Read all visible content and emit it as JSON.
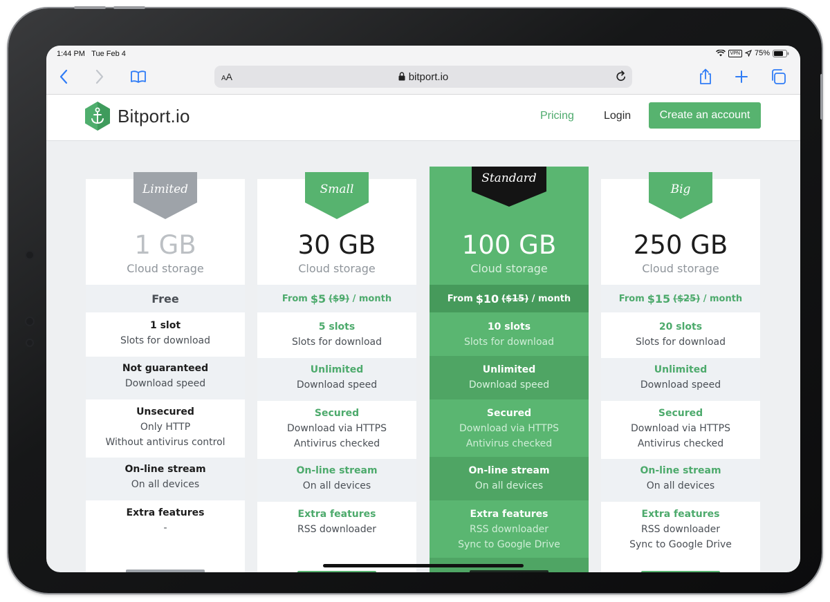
{
  "status": {
    "time": "1:44 PM",
    "date": "Tue Feb 4",
    "vpn": "VPN",
    "battery": "75%"
  },
  "browser": {
    "text_size_label_small": "A",
    "text_size_label_large": "A",
    "host": "bitport.io"
  },
  "site": {
    "logo_text": "Bitport.io",
    "nav_pricing": "Pricing",
    "nav_login": "Login",
    "cta": "Create an account",
    "accent": "#57b36f"
  },
  "plans": [
    {
      "name": "Limited",
      "size": "1 GB",
      "sub": "Cloud storage",
      "price_free": "Free",
      "slots_title": "1 slot",
      "slots_desc": "Slots for download",
      "speed_title": "Not guaranteed",
      "speed_desc": "Download speed",
      "sec_title": "Unsecured",
      "sec_desc1": "Only HTTP",
      "sec_desc2": "Without antivirus control",
      "stream_title": "On-line stream",
      "stream_desc": "On all devices",
      "extra_title": "Extra features",
      "extra_desc1": "-"
    },
    {
      "name": "Small",
      "size": "30 GB",
      "sub": "Cloud storage",
      "price_from": "From",
      "price": "$5",
      "price_old": "($9)",
      "price_per": "/ month",
      "slots_title": "5 slots",
      "slots_desc": "Slots for download",
      "speed_title": "Unlimited",
      "speed_desc": "Download speed",
      "sec_title": "Secured",
      "sec_desc1": "Download via HTTPS",
      "sec_desc2": "Antivirus checked",
      "stream_title": "On-line stream",
      "stream_desc": "On all devices",
      "extra_title": "Extra features",
      "extra_desc1": "RSS downloader"
    },
    {
      "name": "Standard",
      "size": "100 GB",
      "sub": "Cloud storage",
      "price_from": "From",
      "price": "$10",
      "price_old": "($15)",
      "price_per": "/ month",
      "slots_title": "10 slots",
      "slots_desc": "Slots for download",
      "speed_title": "Unlimited",
      "speed_desc": "Download speed",
      "sec_title": "Secured",
      "sec_desc1": "Download via HTTPS",
      "sec_desc2": "Antivirus checked",
      "stream_title": "On-line stream",
      "stream_desc": "On all devices",
      "extra_title": "Extra features",
      "extra_desc1": "RSS downloader",
      "extra_desc2": "Sync to Google Drive"
    },
    {
      "name": "Big",
      "size": "250 GB",
      "sub": "Cloud storage",
      "price_from": "From",
      "price": "$15",
      "price_old": "($25)",
      "price_per": "/ month",
      "slots_title": "20 slots",
      "slots_desc": "Slots for download",
      "speed_title": "Unlimited",
      "speed_desc": "Download speed",
      "sec_title": "Secured",
      "sec_desc1": "Download via HTTPS",
      "sec_desc2": "Antivirus checked",
      "stream_title": "On-line stream",
      "stream_desc": "On all devices",
      "extra_title": "Extra features",
      "extra_desc1": "RSS downloader",
      "extra_desc2": "Sync to Google Drive"
    }
  ]
}
